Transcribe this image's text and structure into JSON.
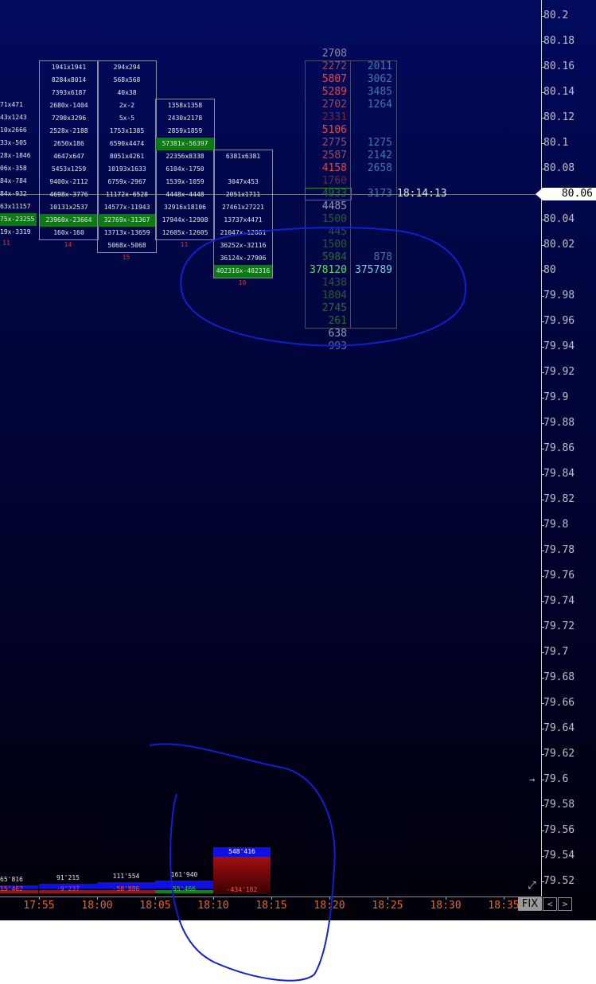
{
  "y_axis": [
    "80.2",
    "80.18",
    "80.16",
    "80.14",
    "80.12",
    "80.1",
    "80.08",
    "80.06",
    "80.04",
    "80.02",
    "80",
    "79.98",
    "79.96",
    "79.94",
    "79.92",
    "79.9",
    "79.88",
    "79.86",
    "79.84",
    "79.82",
    "79.8",
    "79.78",
    "79.76",
    "79.74",
    "79.72",
    "79.7",
    "79.68",
    "79.66",
    "79.64",
    "79.62",
    "79.6",
    "79.58",
    "79.56",
    "79.54",
    "79.52"
  ],
  "current_price": "80.06",
  "current_time": "18:14:13",
  "x_axis": [
    "17:55",
    "18:00",
    "18:05",
    "18:10",
    "18:15",
    "18:20",
    "18:25",
    "18:30",
    "18:35"
  ],
  "fix_label": "FIX",
  "nav": {
    "prev_icon": "<",
    "next_icon": ">"
  },
  "partial_cluster": {
    "rows": [
      "71x471",
      "43x1243",
      "10x2666",
      "33x-505",
      "28x-1846",
      "06x-358",
      "84x-784",
      "84x-932",
      "63x11157",
      "75x-23255",
      "19x-3319"
    ],
    "count": "11"
  },
  "clusters": [
    {
      "rows": [
        "1941x1941",
        "8284x8014",
        "7393x6187",
        "2680x-1404",
        "7290x3296",
        "2528x-2188",
        "2650x186",
        "4647x647",
        "5453x1259",
        "9400x-2112",
        "4698x-3776",
        "10131x2537",
        "23960x-23664",
        "160x-160"
      ],
      "highlight": 12,
      "count": "14"
    },
    {
      "rows": [
        "294x294",
        "568x568",
        "40x38",
        "2x-2",
        "5x-5",
        "1753x1385",
        "6590x4474",
        "8051x4261",
        "10193x1633",
        "6759x-2967",
        "11172x-6528",
        "14577x-11943",
        "32769x-31367",
        "13713x-13659",
        "5068x-5068"
      ],
      "highlight": 12,
      "count": "15"
    },
    {
      "rows": [
        "1358x1358",
        "2430x2178",
        "2859x1859",
        "57381x-56397",
        "22356x8338",
        "6104x-1750",
        "1539x-1059",
        "4448x-4448",
        "32916x18106",
        "17944x-12908",
        "12605x-12605"
      ],
      "highlight": 3,
      "count": "11"
    },
    {
      "rows": [
        "6381x6381",
        "",
        "3047x453",
        "2051x1711",
        "27461x27221",
        "13737x4471",
        "21047x-12081",
        "36252x-32116",
        "36124x-27906",
        "402316x-402316"
      ],
      "highlight": 9,
      "count": "10"
    }
  ],
  "ladder": {
    "left": [
      "2708",
      "2272",
      "5807",
      "5289",
      "2702",
      "2331",
      "5106",
      "2775",
      "2587",
      "4158",
      "1760",
      "4933",
      "4485",
      "1500",
      "445",
      "1500",
      "5984",
      "378120",
      "1438",
      "1804",
      "2745",
      "261",
      "638",
      "993"
    ],
    "right": [
      "",
      "2011",
      "3062",
      "3485",
      "1264",
      "",
      "",
      "1275",
      "2142",
      "2658",
      "",
      "3173",
      "",
      "",
      "",
      "",
      "878",
      "375789",
      "",
      "",
      "",
      "",
      "",
      ""
    ],
    "left_colors": [
      "#8a8aa0",
      "#9c4a60",
      "#e04a4a",
      "#e04a4a",
      "#9c4a60",
      "#6a2a44",
      "#e04a4a",
      "#9c4a60",
      "#9c4a60",
      "#e04a4a",
      "#6a2a44",
      "#2a6a3a",
      "#9a9ab0",
      "#2a5a3a",
      "#2a5a3a",
      "#2a5a3a",
      "#2a6a3a",
      "#5ae06a",
      "#2a5a3a",
      "#2a5a3a",
      "#2a6a3a",
      "#2a6a3a",
      "#9a9ab0",
      "#5a6ab0"
    ],
    "right_colors": [
      "",
      "#3a7ab0",
      "#3a7ab0",
      "#3a7ab0",
      "#3a7ab0",
      "",
      "",
      "#3a7ab0",
      "#3a7ab0",
      "#3a7ab0",
      "",
      "#3a7ab0",
      "",
      "",
      "",
      "",
      "#3a7ab0",
      "#6ad8f0",
      "",
      "",
      "",
      "",
      "",
      ""
    ]
  },
  "volume": [
    {
      "top": "65'816",
      "bottom": "15'462"
    },
    {
      "top": "91'215",
      "bottom": "-9'237"
    },
    {
      "top": "111'554",
      "bottom": "-58'886"
    },
    {
      "top": "161'940",
      "bottom": "55'466"
    },
    {
      "top": "548'416",
      "bottom": "-434'182"
    }
  ]
}
